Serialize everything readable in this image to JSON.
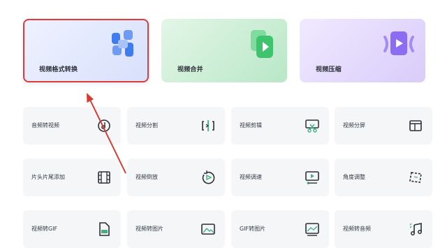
{
  "feature_cards": [
    {
      "label": "视频格式转换",
      "icon": "format-convert-icon",
      "selected": true
    },
    {
      "label": "视频合并",
      "icon": "video-merge-icon"
    },
    {
      "label": "视频压缩",
      "icon": "video-compress-icon"
    }
  ],
  "tools": [
    {
      "label": "音频转视频",
      "icon": "audio-disc-icon"
    },
    {
      "label": "视频分割",
      "icon": "split-icon"
    },
    {
      "label": "视频剪辑",
      "icon": "scissors-icon"
    },
    {
      "label": "视频分屏",
      "icon": "split-screen-icon"
    },
    {
      "label": "片头片尾添加",
      "icon": "film-strip-icon"
    },
    {
      "label": "视频倒放",
      "icon": "reverse-play-icon"
    },
    {
      "label": "视频调速",
      "icon": "speed-screen-icon"
    },
    {
      "label": "角度调整",
      "icon": "rotate-angle-icon"
    },
    {
      "label": "视频转GIF",
      "icon": "gif-file-icon"
    },
    {
      "label": "视频转图片",
      "icon": "image-icon"
    },
    {
      "label": "GIF转图片",
      "icon": "gif-to-image-icon"
    },
    {
      "label": "视频转音频",
      "icon": "music-note-icon"
    }
  ],
  "colors": {
    "highlight_border": "#e03a3a",
    "arrow": "#d93a2f",
    "accent_blue": "#3f7cf0",
    "accent_green": "#4ac97a",
    "accent_purple": "#8b6cf3"
  }
}
